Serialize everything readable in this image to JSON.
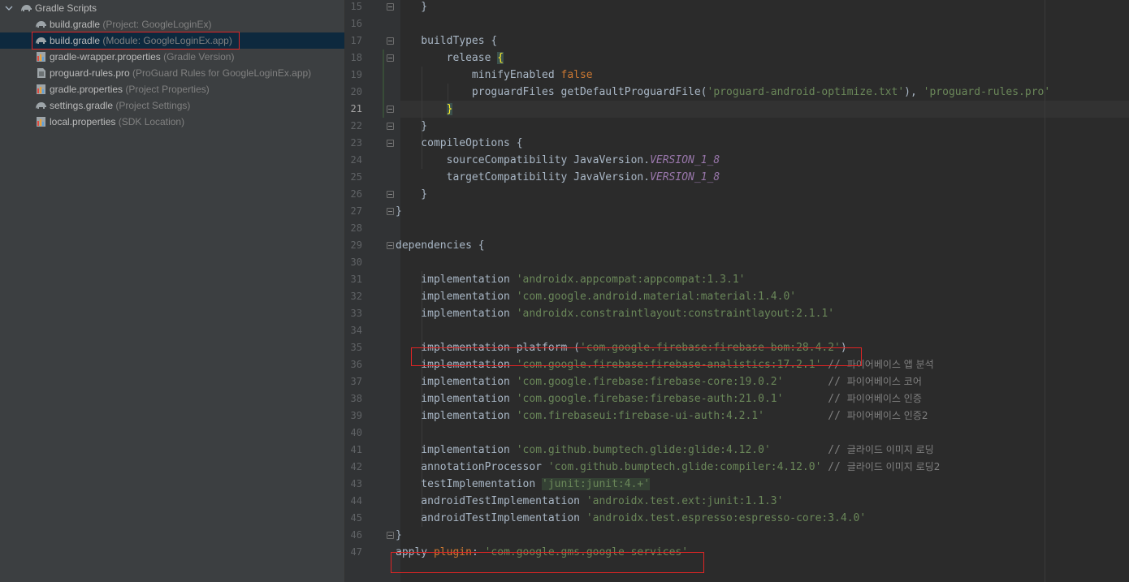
{
  "project_tree": {
    "root": {
      "label": "Gradle Scripts",
      "icon": "gradle-elephant-icon",
      "chevron": "chevron-down-icon"
    },
    "items": [
      {
        "name": "build.gradle",
        "hint": "(Project: GoogleLoginEx)",
        "icon": "gradle-elephant-icon",
        "selected": false
      },
      {
        "name": "build.gradle",
        "hint": "(Module: GoogleLoginEx.app)",
        "icon": "gradle-elephant-icon",
        "selected": true
      },
      {
        "name": "gradle-wrapper.properties",
        "hint": "(Gradle Version)",
        "icon": "properties-file-icon",
        "selected": false
      },
      {
        "name": "proguard-rules.pro",
        "hint": "(ProGuard Rules for GoogleLoginEx.app)",
        "icon": "text-file-icon",
        "selected": false
      },
      {
        "name": "gradle.properties",
        "hint": "(Project Properties)",
        "icon": "properties-file-icon",
        "selected": false
      },
      {
        "name": "settings.gradle",
        "hint": "(Project Settings)",
        "icon": "gradle-elephant-icon",
        "selected": false
      },
      {
        "name": "local.properties",
        "hint": "(SDK Location)",
        "icon": "properties-file-icon",
        "selected": false
      }
    ]
  },
  "editor": {
    "current_line": 21,
    "colors": {
      "keyword": "#cc7832",
      "string": "#6a8759",
      "static_field": "#9876aa",
      "comment": "#808080",
      "text": "#a9b7c6",
      "highlight_box": "#e02525"
    },
    "lines": [
      {
        "num": "15",
        "text": "    }"
      },
      {
        "num": "16",
        "text": ""
      },
      {
        "num": "17",
        "text": "    buildTypes {"
      },
      {
        "num": "18",
        "text": "        release {"
      },
      {
        "num": "19",
        "text": "            minifyEnabled false"
      },
      {
        "num": "20",
        "text": "            proguardFiles getDefaultProguardFile('proguard-android-optimize.txt'), 'proguard-rules.pro'"
      },
      {
        "num": "21",
        "text": "        }"
      },
      {
        "num": "22",
        "text": "    }"
      },
      {
        "num": "23",
        "text": "    compileOptions {"
      },
      {
        "num": "24",
        "text": "        sourceCompatibility JavaVersion.VERSION_1_8"
      },
      {
        "num": "25",
        "text": "        targetCompatibility JavaVersion.VERSION_1_8"
      },
      {
        "num": "26",
        "text": "    }"
      },
      {
        "num": "27",
        "text": "}"
      },
      {
        "num": "28",
        "text": ""
      },
      {
        "num": "29",
        "text": "dependencies {"
      },
      {
        "num": "30",
        "text": ""
      },
      {
        "num": "31",
        "text": "    implementation 'androidx.appcompat:appcompat:1.3.1'"
      },
      {
        "num": "32",
        "text": "    implementation 'com.google.android.material:material:1.4.0'"
      },
      {
        "num": "33",
        "text": "    implementation 'androidx.constraintlayout:constraintlayout:2.1.1'"
      },
      {
        "num": "34",
        "text": ""
      },
      {
        "num": "35",
        "text": "    implementation platform ('com.google.firebase:firebase-bom:28.4.2')"
      },
      {
        "num": "36",
        "text": "    implementation 'com.google.firebase:firebase-analistics:17.2.1' // 파이어베이스 앱 분석"
      },
      {
        "num": "37",
        "text": "    implementation 'com.google.firebase:firebase-core:19.0.2'       // 파이어베이스 코어"
      },
      {
        "num": "38",
        "text": "    implementation 'com.google.firebase:firebase-auth:21.0.1'       // 파이어베이스 인증"
      },
      {
        "num": "39",
        "text": "    implementation 'com.firebaseui:firebase-ui-auth:4.2.1'          // 파이어베이스 인증2"
      },
      {
        "num": "40",
        "text": ""
      },
      {
        "num": "41",
        "text": "    implementation 'com.github.bumptech.glide:glide:4.12.0'         // 글라이드 이미지 로딩"
      },
      {
        "num": "42",
        "text": "    annotationProcessor 'com.github.bumptech.glide:compiler:4.12.0' // 글라이드 이미지 로딩2"
      },
      {
        "num": "43",
        "text": "    testImplementation 'junit:junit:4.+'"
      },
      {
        "num": "44",
        "text": "    androidTestImplementation 'androidx.test.ext:junit:1.1.3'"
      },
      {
        "num": "45",
        "text": "    androidTestImplementation 'androidx.test.espresso:espresso-core:3.4.0'"
      },
      {
        "num": "46",
        "text": "}"
      },
      {
        "num": "47",
        "text": "apply plugin: 'com.google.gms.google-services'"
      }
    ]
  }
}
